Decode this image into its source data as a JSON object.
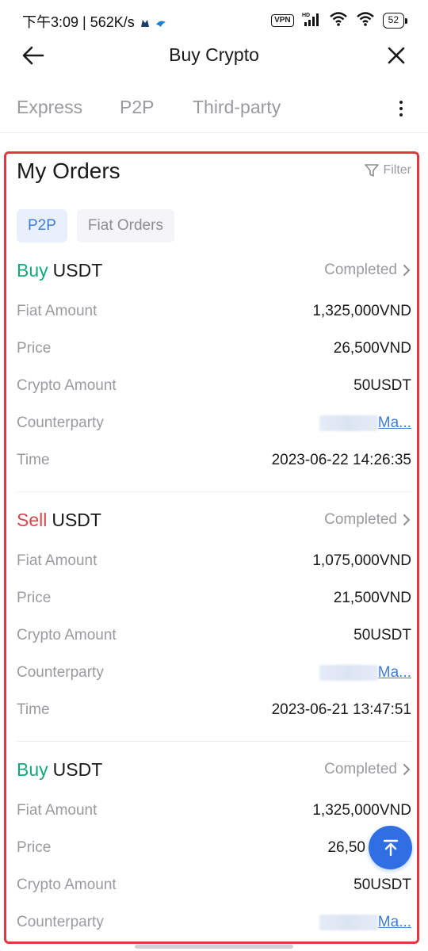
{
  "status_bar": {
    "time_speed": "下午3:09 | 562K/s",
    "vpn": "VPN",
    "hd": "HD",
    "battery": "52"
  },
  "header": {
    "title": "Buy Crypto",
    "back_icon": "arrow-left-icon",
    "close_icon": "close-icon"
  },
  "tabs": [
    {
      "label": "Express"
    },
    {
      "label": "P2P"
    },
    {
      "label": "Third-party"
    }
  ],
  "orders_section": {
    "title": "My Orders",
    "filter_label": "Filter",
    "subtabs": [
      {
        "label": "P2P",
        "active": true
      },
      {
        "label": "Fiat Orders",
        "active": false
      }
    ]
  },
  "orders": [
    {
      "side": "Buy",
      "coin": "USDT",
      "status": "Completed",
      "fiat_amount_label": "Fiat Amount",
      "fiat_amount": "1,325,000VND",
      "price_label": "Price",
      "price": "26,500VND",
      "crypto_amount_label": "Crypto Amount",
      "crypto_amount": "50USDT",
      "counterparty_label": "Counterparty",
      "counterparty": "Ma...",
      "time_label": "Time",
      "time": "2023-06-22 14:26:35"
    },
    {
      "side": "Sell",
      "coin": "USDT",
      "status": "Completed",
      "fiat_amount_label": "Fiat Amount",
      "fiat_amount": "1,075,000VND",
      "price_label": "Price",
      "price": "21,500VND",
      "crypto_amount_label": "Crypto Amount",
      "crypto_amount": "50USDT",
      "counterparty_label": "Counterparty",
      "counterparty": "Ma...",
      "time_label": "Time",
      "time": "2023-06-21 13:47:51"
    },
    {
      "side": "Buy",
      "coin": "USDT",
      "status": "Completed",
      "fiat_amount_label": "Fiat Amount",
      "fiat_amount": "1,325,000VND",
      "price_label": "Price",
      "price": "26,50",
      "crypto_amount_label": "Crypto Amount",
      "crypto_amount": "50USDT",
      "counterparty_label": "Counterparty",
      "counterparty": "Ma..."
    }
  ],
  "colors": {
    "buy": "#12a87a",
    "sell": "#d8474c",
    "accent": "#3f7bd8",
    "highlight": "#e0383e"
  }
}
